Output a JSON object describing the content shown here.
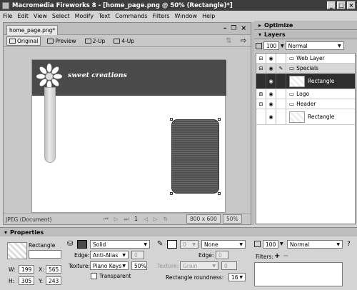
{
  "window": {
    "title": "Macromedia Fireworks 8 - [home_page.png @ 50% (Rectangle)*]",
    "min": "_",
    "max": "□",
    "close": "×"
  },
  "menu": [
    "File",
    "Edit",
    "View",
    "Select",
    "Modify",
    "Text",
    "Commands",
    "Filters",
    "Window",
    "Help"
  ],
  "doc": {
    "tab": "home_page.png*",
    "views": [
      "Original",
      "Preview",
      "2-Up",
      "4-Up"
    ],
    "tagline": "sweet creations",
    "status_format": "JPEG (Document)",
    "page_number": "1",
    "dimensions": "800 x 600",
    "zoom": "50%"
  },
  "panels": {
    "optimize": "Optimize",
    "layers": "Layers",
    "opacity": "100",
    "blend": "Normal",
    "layers_list": [
      {
        "name": "Web Layer"
      },
      {
        "name": "Specials"
      },
      {
        "name": "Rectangle"
      },
      {
        "name": "Logo"
      },
      {
        "name": "Header"
      },
      {
        "name": "Rectangle"
      }
    ]
  },
  "properties": {
    "header": "Properties",
    "object_name": "Rectangle",
    "w_label": "W:",
    "w": "199",
    "x_label": "X:",
    "x": "565",
    "h_label": "H:",
    "h": "305",
    "y_label": "Y:",
    "y": "243",
    "fill_type": "Solid",
    "edge_label": "Edge:",
    "edge": "Anti-Alias",
    "edge_amount": "0",
    "texture_label": "Texture:",
    "texture": "Piano Keys",
    "texture_amount": "50%",
    "transparent_label": "Transparent",
    "stroke_size": "0",
    "stroke_type": "None",
    "stroke_edge_label": "Edge:",
    "stroke_edge_amount": "0",
    "stroke_texture_label": "Texture:",
    "stroke_texture": "Grain",
    "stroke_texture_amount": "0",
    "roundness_label": "Rectangle roundness:",
    "roundness": "16",
    "opacity": "100",
    "blend": "Normal",
    "filters_label": "Filters:"
  },
  "colors": {
    "fill": "#4a4a4a",
    "selection": "#2e2e2e"
  }
}
